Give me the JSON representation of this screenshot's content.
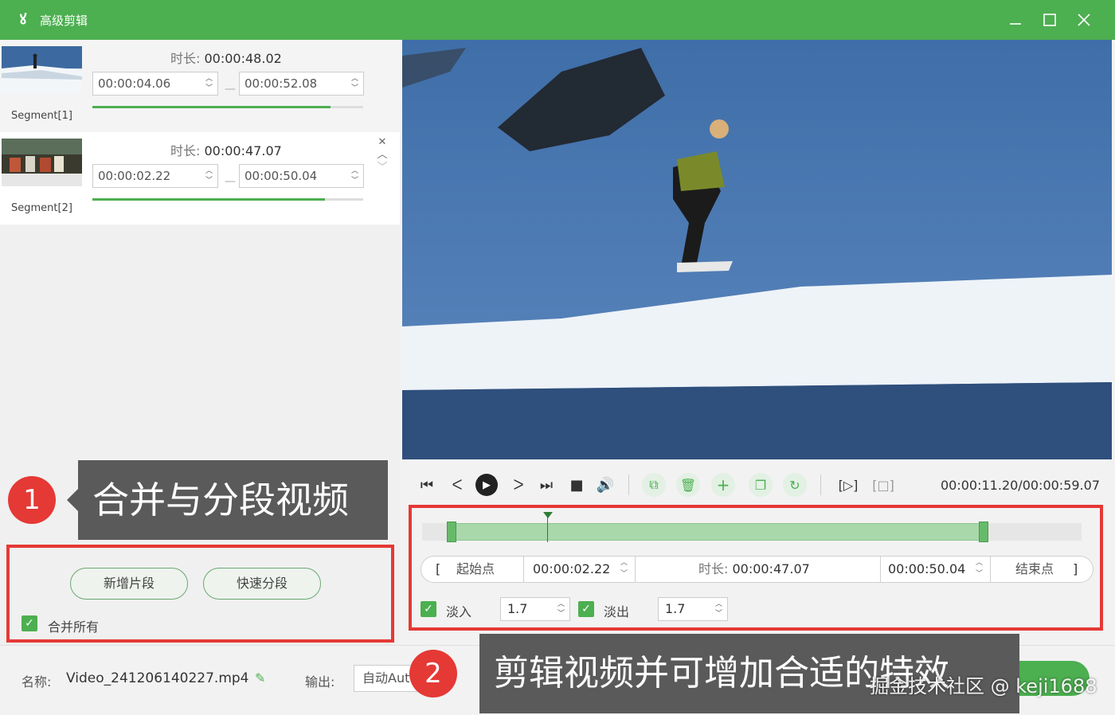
{
  "window": {
    "title": "高级剪辑"
  },
  "segments": [
    {
      "name": "Segment[1]",
      "duration_label": "时长:",
      "duration": "00:00:48.02",
      "start": "00:00:04.06",
      "end": "00:00:52.08",
      "progress": 0.88
    },
    {
      "name": "Segment[2]",
      "duration_label": "时长:",
      "duration": "00:00:47.07",
      "start": "00:00:02.22",
      "end": "00:00:50.04",
      "progress": 0.86
    }
  ],
  "left_actions": {
    "add_segment": "新增片段",
    "quick_split": "快速分段",
    "merge_all": "合并所有",
    "merge_all_checked": true
  },
  "annotations": {
    "step1_number": "1",
    "step1_text": "合并与分段视频",
    "step2_number": "2",
    "step2_text": "剪辑视频并可增加合适的特效"
  },
  "player": {
    "time": "00:00:11.20/00:00:59.07",
    "position_fraction": 0.19
  },
  "trim": {
    "start_label": "起始点",
    "start_value": "00:00:02.22",
    "duration_label": "时长:",
    "duration_value": "00:00:47.07",
    "end_value": "00:00:50.04",
    "end_label": "结束点",
    "selection_start_fraction": 0.042,
    "selection_end_fraction": 0.854
  },
  "fade": {
    "in_label": "淡入",
    "in_value": "1.7",
    "out_label": "淡出",
    "out_value": "1.7"
  },
  "bottom": {
    "name_label": "名称:",
    "file_name": "Video_241206140227.mp4",
    "output_label": "输出:",
    "output_value": "自动Auto"
  },
  "watermark": "掘金技术社区 @ keji1688",
  "colors": {
    "accent": "#4caf50",
    "annotation": "#e53935",
    "callout": "#5a5a5a"
  }
}
